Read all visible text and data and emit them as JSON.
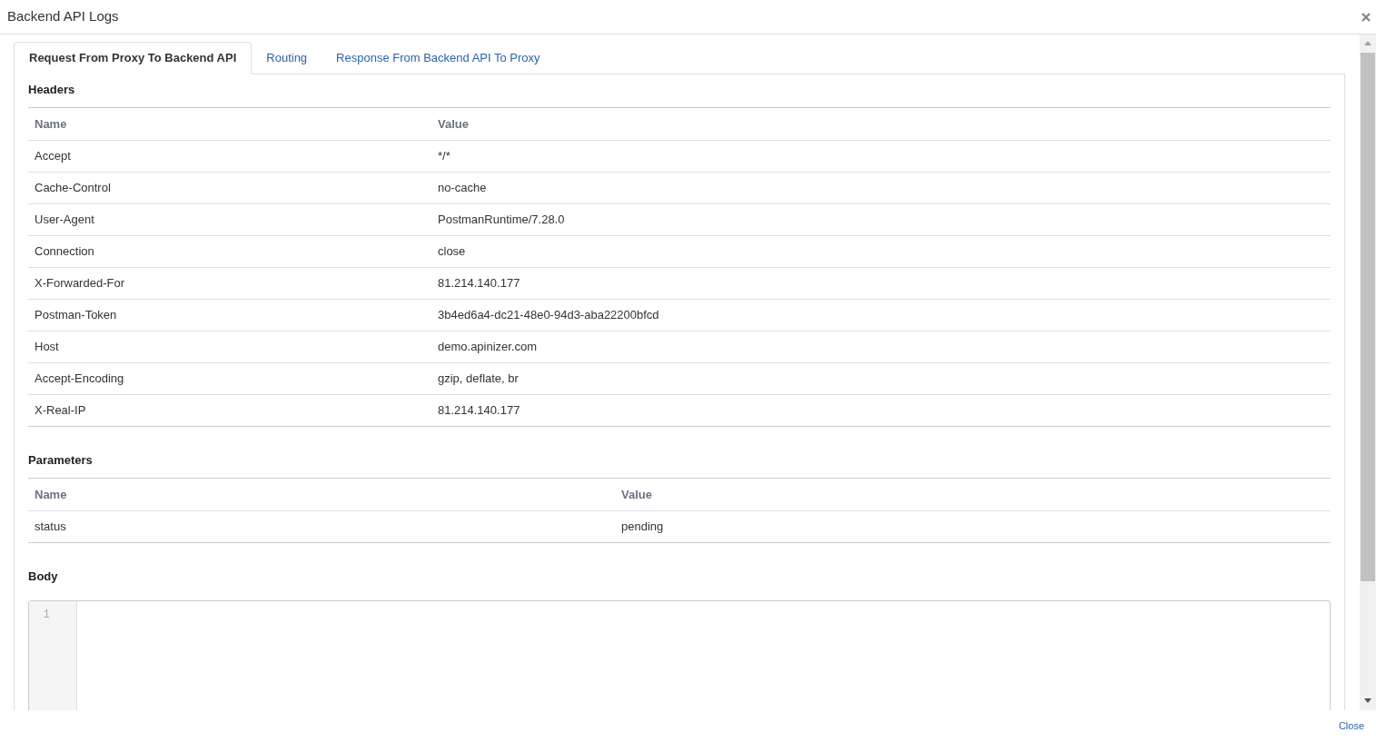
{
  "window": {
    "title": "Backend API Logs"
  },
  "tabs": [
    {
      "label": "Request From Proxy To Backend API",
      "selected": true
    },
    {
      "label": "Routing",
      "selected": false
    },
    {
      "label": "Response From Backend API To Proxy",
      "selected": false
    }
  ],
  "headers": {
    "title": "Headers",
    "columns": [
      "Name",
      "Value"
    ],
    "rows": [
      [
        "Accept",
        "*/*"
      ],
      [
        "Cache-Control",
        "no-cache"
      ],
      [
        "User-Agent",
        "PostmanRuntime/7.28.0"
      ],
      [
        "Connection",
        "close"
      ],
      [
        "X-Forwarded-For",
        "81.214.140.177"
      ],
      [
        "Postman-Token",
        "3b4ed6a4-dc21-48e0-94d3-aba22200bfcd"
      ],
      [
        "Host",
        "demo.apinizer.com"
      ],
      [
        "Accept-Encoding",
        "gzip, deflate, br"
      ],
      [
        "X-Real-IP",
        "81.214.140.177"
      ]
    ]
  },
  "parameters": {
    "title": "Parameters",
    "columns": [
      "Name",
      "Value"
    ],
    "rows": [
      [
        "status",
        "pending"
      ]
    ]
  },
  "body": {
    "title": "Body",
    "line_numbers": [
      "1"
    ]
  },
  "footer": {
    "close": "Close"
  }
}
